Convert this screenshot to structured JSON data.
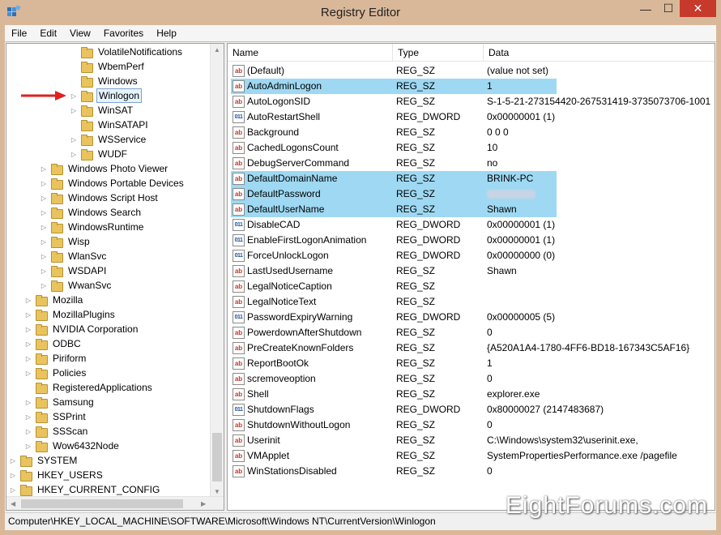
{
  "window": {
    "title": "Registry Editor",
    "minimize": "—",
    "maximize": "☐",
    "close": "✕"
  },
  "menu": [
    "File",
    "Edit",
    "View",
    "Favorites",
    "Help"
  ],
  "tree": [
    {
      "label": "VolatileNotifications",
      "level": 3,
      "expander": false,
      "selected": false
    },
    {
      "label": "WbemPerf",
      "level": 3,
      "expander": false,
      "selected": false
    },
    {
      "label": "Windows",
      "level": 3,
      "expander": false,
      "selected": false
    },
    {
      "label": "Winlogon",
      "level": 3,
      "expander": true,
      "selected": true
    },
    {
      "label": "WinSAT",
      "level": 3,
      "expander": true,
      "selected": false
    },
    {
      "label": "WinSATAPI",
      "level": 3,
      "expander": false,
      "selected": false
    },
    {
      "label": "WSService",
      "level": 3,
      "expander": true,
      "selected": false
    },
    {
      "label": "WUDF",
      "level": 3,
      "expander": true,
      "selected": false
    },
    {
      "label": "Windows Photo Viewer",
      "level": 2,
      "expander": true,
      "selected": false
    },
    {
      "label": "Windows Portable Devices",
      "level": 2,
      "expander": true,
      "selected": false
    },
    {
      "label": "Windows Script Host",
      "level": 2,
      "expander": true,
      "selected": false
    },
    {
      "label": "Windows Search",
      "level": 2,
      "expander": true,
      "selected": false
    },
    {
      "label": "WindowsRuntime",
      "level": 2,
      "expander": true,
      "selected": false
    },
    {
      "label": "Wisp",
      "level": 2,
      "expander": true,
      "selected": false
    },
    {
      "label": "WlanSvc",
      "level": 2,
      "expander": true,
      "selected": false
    },
    {
      "label": "WSDAPI",
      "level": 2,
      "expander": true,
      "selected": false
    },
    {
      "label": "WwanSvc",
      "level": 2,
      "expander": true,
      "selected": false
    },
    {
      "label": "Mozilla",
      "level": 1,
      "expander": true,
      "selected": false
    },
    {
      "label": "MozillaPlugins",
      "level": 1,
      "expander": true,
      "selected": false
    },
    {
      "label": "NVIDIA Corporation",
      "level": 1,
      "expander": true,
      "selected": false
    },
    {
      "label": "ODBC",
      "level": 1,
      "expander": true,
      "selected": false
    },
    {
      "label": "Piriform",
      "level": 1,
      "expander": true,
      "selected": false
    },
    {
      "label": "Policies",
      "level": 1,
      "expander": true,
      "selected": false
    },
    {
      "label": "RegisteredApplications",
      "level": 1,
      "expander": false,
      "selected": false
    },
    {
      "label": "Samsung",
      "level": 1,
      "expander": true,
      "selected": false
    },
    {
      "label": "SSPrint",
      "level": 1,
      "expander": true,
      "selected": false
    },
    {
      "label": "SSScan",
      "level": 1,
      "expander": true,
      "selected": false
    },
    {
      "label": "Wow6432Node",
      "level": 1,
      "expander": true,
      "selected": false
    },
    {
      "label": "SYSTEM",
      "level": 0,
      "expander": true,
      "selected": false
    },
    {
      "label": "HKEY_USERS",
      "level": -1,
      "expander": true,
      "selected": false
    },
    {
      "label": "HKEY_CURRENT_CONFIG",
      "level": -1,
      "expander": true,
      "selected": false
    }
  ],
  "columns": {
    "name": "Name",
    "type": "Type",
    "data": "Data"
  },
  "values": [
    {
      "name": "(Default)",
      "type": "REG_SZ",
      "data": "(value not set)",
      "highlight": false
    },
    {
      "name": "AutoAdminLogon",
      "type": "REG_SZ",
      "data": "1",
      "highlight": true
    },
    {
      "name": "AutoLogonSID",
      "type": "REG_SZ",
      "data": "S-1-5-21-273154420-267531419-3735073706-1001",
      "highlight": false
    },
    {
      "name": "AutoRestartShell",
      "type": "REG_DWORD",
      "data": "0x00000001 (1)",
      "highlight": false
    },
    {
      "name": "Background",
      "type": "REG_SZ",
      "data": "0 0 0",
      "highlight": false
    },
    {
      "name": "CachedLogonsCount",
      "type": "REG_SZ",
      "data": "10",
      "highlight": false
    },
    {
      "name": "DebugServerCommand",
      "type": "REG_SZ",
      "data": "no",
      "highlight": false
    },
    {
      "name": "DefaultDomainName",
      "type": "REG_SZ",
      "data": "BRINK-PC",
      "highlight": true
    },
    {
      "name": "DefaultPassword",
      "type": "REG_SZ",
      "data": "",
      "highlight": true,
      "blurred": true
    },
    {
      "name": "DefaultUserName",
      "type": "REG_SZ",
      "data": "Shawn",
      "highlight": true
    },
    {
      "name": "DisableCAD",
      "type": "REG_DWORD",
      "data": "0x00000001 (1)",
      "highlight": false
    },
    {
      "name": "EnableFirstLogonAnimation",
      "type": "REG_DWORD",
      "data": "0x00000001 (1)",
      "highlight": false
    },
    {
      "name": "ForceUnlockLogon",
      "type": "REG_DWORD",
      "data": "0x00000000 (0)",
      "highlight": false
    },
    {
      "name": "LastUsedUsername",
      "type": "REG_SZ",
      "data": "Shawn",
      "highlight": false
    },
    {
      "name": "LegalNoticeCaption",
      "type": "REG_SZ",
      "data": "",
      "highlight": false
    },
    {
      "name": "LegalNoticeText",
      "type": "REG_SZ",
      "data": "",
      "highlight": false
    },
    {
      "name": "PasswordExpiryWarning",
      "type": "REG_DWORD",
      "data": "0x00000005 (5)",
      "highlight": false
    },
    {
      "name": "PowerdownAfterShutdown",
      "type": "REG_SZ",
      "data": "0",
      "highlight": false
    },
    {
      "name": "PreCreateKnownFolders",
      "type": "REG_SZ",
      "data": "{A520A1A4-1780-4FF6-BD18-167343C5AF16}",
      "highlight": false
    },
    {
      "name": "ReportBootOk",
      "type": "REG_SZ",
      "data": "1",
      "highlight": false
    },
    {
      "name": "scremoveoption",
      "type": "REG_SZ",
      "data": "0",
      "highlight": false
    },
    {
      "name": "Shell",
      "type": "REG_SZ",
      "data": "explorer.exe",
      "highlight": false
    },
    {
      "name": "ShutdownFlags",
      "type": "REG_DWORD",
      "data": "0x80000027 (2147483687)",
      "highlight": false
    },
    {
      "name": "ShutdownWithoutLogon",
      "type": "REG_SZ",
      "data": "0",
      "highlight": false
    },
    {
      "name": "Userinit",
      "type": "REG_SZ",
      "data": "C:\\Windows\\system32\\userinit.exe,",
      "highlight": false
    },
    {
      "name": "VMApplet",
      "type": "REG_SZ",
      "data": "SystemPropertiesPerformance.exe /pagefile",
      "highlight": false
    },
    {
      "name": "WinStationsDisabled",
      "type": "REG_SZ",
      "data": "0",
      "highlight": false
    }
  ],
  "status": "Computer\\HKEY_LOCAL_MACHINE\\SOFTWARE\\Microsoft\\Windows NT\\CurrentVersion\\Winlogon",
  "watermark": "EightForums.com",
  "colors": {
    "highlight": "#9ed8f2",
    "selection_border": "#7da2ce",
    "close_button": "#c7392b",
    "arrow": "#e02020"
  }
}
